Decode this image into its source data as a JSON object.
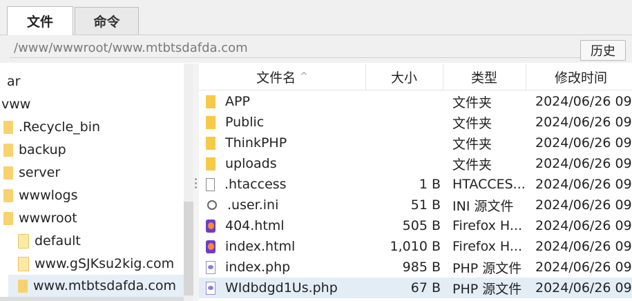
{
  "tabs": [
    {
      "label": "文件",
      "active": true
    },
    {
      "label": "命令",
      "active": false
    }
  ],
  "path": {
    "value": "/www/wwwroot/www.mtbtsdafda.com"
  },
  "history_button": "历史",
  "tree": {
    "items": [
      {
        "label": "ar",
        "icon": "none",
        "selected": false
      },
      {
        "label": "vww",
        "icon": "none",
        "selected": false
      },
      {
        "label": ".Recycle_bin",
        "icon": "folder-icon",
        "selected": false
      },
      {
        "label": "backup",
        "icon": "folder-icon",
        "selected": false
      },
      {
        "label": "server",
        "icon": "folder-icon",
        "selected": false
      },
      {
        "label": "wwwlogs",
        "icon": "folder-icon",
        "selected": false
      },
      {
        "label": "wwwroot",
        "icon": "folder-icon",
        "selected": false
      },
      {
        "label": "default",
        "icon": "folder-icon",
        "selected": false
      },
      {
        "label": "www.gSJKsu2kig.com",
        "icon": "folder-icon",
        "selected": false
      },
      {
        "label": "www.mtbtsdafda.com",
        "icon": "folder-icon",
        "selected": true
      }
    ]
  },
  "list": {
    "columns": [
      "文件名",
      "大小",
      "类型",
      "修改时间"
    ],
    "sort_indicator": "^",
    "rows": [
      {
        "name": "APP",
        "size": "",
        "type": "文件夹",
        "date": "2024/06/26 09",
        "icon": "folder-icon"
      },
      {
        "name": "Public",
        "size": "",
        "type": "文件夹",
        "date": "2024/06/26 09",
        "icon": "folder-icon"
      },
      {
        "name": "ThinkPHP",
        "size": "",
        "type": "文件夹",
        "date": "2024/06/26 09",
        "icon": "folder-icon"
      },
      {
        "name": "uploads",
        "size": "",
        "type": "文件夹",
        "date": "2024/06/26 09",
        "icon": "folder-icon"
      },
      {
        "name": ".htaccess",
        "size": "1 B",
        "type": "HTACCES...",
        "date": "2024/06/26 09",
        "icon": "file-icon"
      },
      {
        "name": ".user.ini",
        "size": "51 B",
        "type": "INI 源文件",
        "date": "2024/06/26 09",
        "icon": "gear-icon"
      },
      {
        "name": "404.html",
        "size": "505 B",
        "type": "Firefox H...",
        "date": "2024/06/26 09",
        "icon": "firefox-icon"
      },
      {
        "name": "index.html",
        "size": "1,010 B",
        "type": "Firefox H...",
        "date": "2024/06/26 09",
        "icon": "firefox-icon"
      },
      {
        "name": "index.php",
        "size": "985 B",
        "type": "PHP 源文件",
        "date": "2024/06/26 09",
        "icon": "php-icon"
      },
      {
        "name": "WIdbdgd1Us.php",
        "size": "67 B",
        "type": "PHP 源文件",
        "date": "2024/06/26 09",
        "icon": "php-icon",
        "selected": true
      }
    ]
  }
}
